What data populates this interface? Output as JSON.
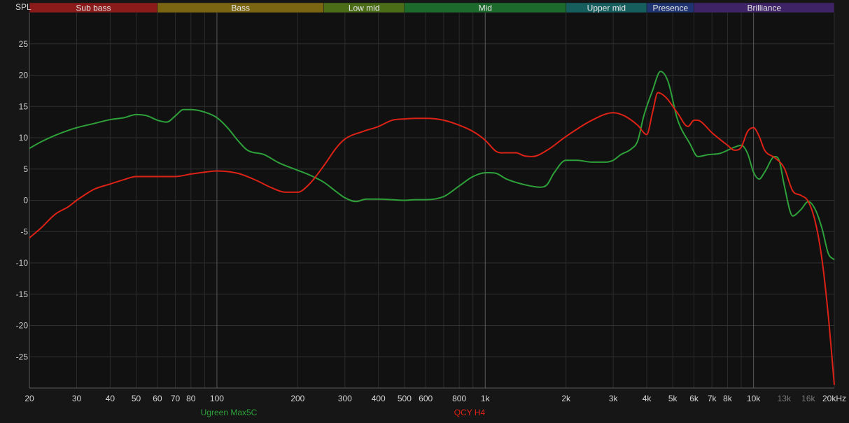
{
  "chart_data": {
    "type": "line",
    "title": "",
    "ylabel": "SPL",
    "xlabel": "",
    "x_scale": "log",
    "xlim": [
      20,
      20000
    ],
    "ylim": [
      -30,
      30
    ],
    "y_ticks": [
      25,
      20,
      15,
      10,
      5,
      0,
      -5,
      -10,
      -15,
      -20,
      -25
    ],
    "x_ticks": [
      {
        "value": 20,
        "label": "20",
        "dim": false
      },
      {
        "value": 30,
        "label": "30",
        "dim": false
      },
      {
        "value": 40,
        "label": "40",
        "dim": false
      },
      {
        "value": 50,
        "label": "50",
        "dim": false
      },
      {
        "value": 60,
        "label": "60",
        "dim": false
      },
      {
        "value": 70,
        "label": "70",
        "dim": false
      },
      {
        "value": 80,
        "label": "80",
        "dim": false
      },
      {
        "value": 100,
        "label": "100",
        "dim": false
      },
      {
        "value": 200,
        "label": "200",
        "dim": false
      },
      {
        "value": 300,
        "label": "300",
        "dim": false
      },
      {
        "value": 400,
        "label": "400",
        "dim": false
      },
      {
        "value": 500,
        "label": "500",
        "dim": false
      },
      {
        "value": 600,
        "label": "600",
        "dim": false
      },
      {
        "value": 800,
        "label": "800",
        "dim": false
      },
      {
        "value": 1000,
        "label": "1k",
        "dim": false
      },
      {
        "value": 2000,
        "label": "2k",
        "dim": false
      },
      {
        "value": 3000,
        "label": "3k",
        "dim": false
      },
      {
        "value": 4000,
        "label": "4k",
        "dim": false
      },
      {
        "value": 5000,
        "label": "5k",
        "dim": false
      },
      {
        "value": 6000,
        "label": "6k",
        "dim": false
      },
      {
        "value": 7000,
        "label": "7k",
        "dim": false
      },
      {
        "value": 8000,
        "label": "8k",
        "dim": false
      },
      {
        "value": 10000,
        "label": "10k",
        "dim": false
      },
      {
        "value": 13000,
        "label": "13k",
        "dim": true
      },
      {
        "value": 16000,
        "label": "16k",
        "dim": true
      },
      {
        "value": 20000,
        "label": "20kHz",
        "dim": false
      }
    ],
    "minor_gridlines": [
      20,
      30,
      40,
      50,
      60,
      70,
      80,
      90,
      100,
      200,
      300,
      400,
      500,
      600,
      700,
      800,
      900,
      1000,
      2000,
      3000,
      4000,
      5000,
      6000,
      7000,
      8000,
      9000,
      10000,
      20000
    ],
    "major_gridlines": [
      100,
      1000,
      10000
    ],
    "bands": [
      {
        "label": "Sub bass",
        "from": 20,
        "to": 60,
        "color": "#8b1a1a"
      },
      {
        "label": "Bass",
        "from": 60,
        "to": 250,
        "color": "#7a6512"
      },
      {
        "label": "Low mid",
        "from": 250,
        "to": 500,
        "color": "#4c6d18"
      },
      {
        "label": "Mid",
        "from": 500,
        "to": 2000,
        "color": "#1c6a2c"
      },
      {
        "label": "Upper mid",
        "from": 2000,
        "to": 4000,
        "color": "#165e5e"
      },
      {
        "label": "Presence",
        "from": 4000,
        "to": 6000,
        "color": "#1f3470"
      },
      {
        "label": "Brilliance",
        "from": 6000,
        "to": 20000,
        "color": "#3e2466"
      }
    ],
    "series": [
      {
        "name": "Ugreen Max5C",
        "color": "#2ea03a",
        "points": [
          [
            20,
            8.3
          ],
          [
            22,
            9.3
          ],
          [
            25,
            10.4
          ],
          [
            28,
            11.2
          ],
          [
            30,
            11.6
          ],
          [
            35,
            12.3
          ],
          [
            40,
            12.9
          ],
          [
            45,
            13.2
          ],
          [
            50,
            13.7
          ],
          [
            55,
            13.5
          ],
          [
            60,
            12.8
          ],
          [
            65,
            12.5
          ],
          [
            70,
            13.5
          ],
          [
            75,
            14.5
          ],
          [
            80,
            14.5
          ],
          [
            90,
            14.1
          ],
          [
            100,
            13.2
          ],
          [
            110,
            11.5
          ],
          [
            120,
            9.5
          ],
          [
            130,
            8.0
          ],
          [
            150,
            7.3
          ],
          [
            170,
            6.0
          ],
          [
            200,
            4.8
          ],
          [
            220,
            4.1
          ],
          [
            250,
            2.9
          ],
          [
            280,
            1.3
          ],
          [
            300,
            0.4
          ],
          [
            330,
            -0.2
          ],
          [
            360,
            0.2
          ],
          [
            400,
            0.2
          ],
          [
            450,
            0.1
          ],
          [
            500,
            0.0
          ],
          [
            550,
            0.1
          ],
          [
            600,
            0.1
          ],
          [
            700,
            0.6
          ],
          [
            800,
            2.3
          ],
          [
            900,
            3.8
          ],
          [
            1000,
            4.4
          ],
          [
            1100,
            4.3
          ],
          [
            1200,
            3.4
          ],
          [
            1400,
            2.5
          ],
          [
            1600,
            2.1
          ],
          [
            1700,
            2.5
          ],
          [
            1800,
            4.3
          ],
          [
            2000,
            6.4
          ],
          [
            2200,
            6.4
          ],
          [
            2500,
            6.1
          ],
          [
            2800,
            6.1
          ],
          [
            3000,
            6.4
          ],
          [
            3200,
            7.3
          ],
          [
            3500,
            8.2
          ],
          [
            3700,
            9.5
          ],
          [
            3900,
            13.5
          ],
          [
            4200,
            17.5
          ],
          [
            4500,
            20.6
          ],
          [
            4800,
            19.0
          ],
          [
            5200,
            13.0
          ],
          [
            5800,
            9.0
          ],
          [
            6200,
            7.0
          ],
          [
            6800,
            7.3
          ],
          [
            7500,
            7.5
          ],
          [
            8500,
            8.5
          ],
          [
            9000,
            8.8
          ],
          [
            9500,
            7.5
          ],
          [
            10000,
            4.5
          ],
          [
            10500,
            3.4
          ],
          [
            11000,
            4.5
          ],
          [
            12000,
            7.0
          ],
          [
            12500,
            6.2
          ],
          [
            13000,
            2.5
          ],
          [
            14000,
            -2.5
          ],
          [
            15000,
            -1.5
          ],
          [
            16000,
            -0.2
          ],
          [
            17000,
            -1.5
          ],
          [
            18000,
            -4.5
          ],
          [
            19000,
            -8.5
          ],
          [
            20000,
            -9.5
          ]
        ]
      },
      {
        "name": "QCY H4",
        "color": "#dc2216",
        "points": [
          [
            20,
            -6.0
          ],
          [
            22,
            -4.5
          ],
          [
            25,
            -2.2
          ],
          [
            28,
            -1.0
          ],
          [
            30,
            0.0
          ],
          [
            35,
            1.8
          ],
          [
            40,
            2.6
          ],
          [
            45,
            3.3
          ],
          [
            50,
            3.8
          ],
          [
            55,
            3.8
          ],
          [
            60,
            3.8
          ],
          [
            70,
            3.8
          ],
          [
            80,
            4.2
          ],
          [
            90,
            4.5
          ],
          [
            100,
            4.7
          ],
          [
            120,
            4.3
          ],
          [
            140,
            3.2
          ],
          [
            160,
            2.0
          ],
          [
            180,
            1.3
          ],
          [
            200,
            1.3
          ],
          [
            220,
            2.5
          ],
          [
            250,
            5.5
          ],
          [
            280,
            8.5
          ],
          [
            300,
            9.8
          ],
          [
            350,
            11.0
          ],
          [
            400,
            11.8
          ],
          [
            450,
            12.8
          ],
          [
            500,
            13.0
          ],
          [
            550,
            13.1
          ],
          [
            600,
            13.1
          ],
          [
            700,
            12.8
          ],
          [
            800,
            12.0
          ],
          [
            900,
            11.0
          ],
          [
            1000,
            9.6
          ],
          [
            1100,
            7.8
          ],
          [
            1200,
            7.6
          ],
          [
            1300,
            7.6
          ],
          [
            1400,
            7.1
          ],
          [
            1500,
            7.0
          ],
          [
            1700,
            8.0
          ],
          [
            2000,
            10.2
          ],
          [
            2500,
            12.8
          ],
          [
            3000,
            14.0
          ],
          [
            3300,
            13.5
          ],
          [
            3700,
            12.0
          ],
          [
            4000,
            10.5
          ],
          [
            4200,
            14.0
          ],
          [
            4400,
            17.2
          ],
          [
            4700,
            16.5
          ],
          [
            5200,
            14.0
          ],
          [
            5700,
            11.8
          ],
          [
            6000,
            12.8
          ],
          [
            6300,
            12.7
          ],
          [
            7000,
            10.8
          ],
          [
            8000,
            8.8
          ],
          [
            8500,
            8.0
          ],
          [
            9000,
            8.5
          ],
          [
            9500,
            11.0
          ],
          [
            10000,
            11.6
          ],
          [
            10500,
            10.2
          ],
          [
            11000,
            8.0
          ],
          [
            12000,
            6.8
          ],
          [
            13000,
            5.2
          ],
          [
            14000,
            1.5
          ],
          [
            15000,
            0.8
          ],
          [
            16000,
            -0.2
          ],
          [
            17000,
            -3.5
          ],
          [
            18000,
            -9.5
          ],
          [
            19000,
            -18.5
          ],
          [
            20000,
            -29.5
          ]
        ]
      }
    ]
  }
}
